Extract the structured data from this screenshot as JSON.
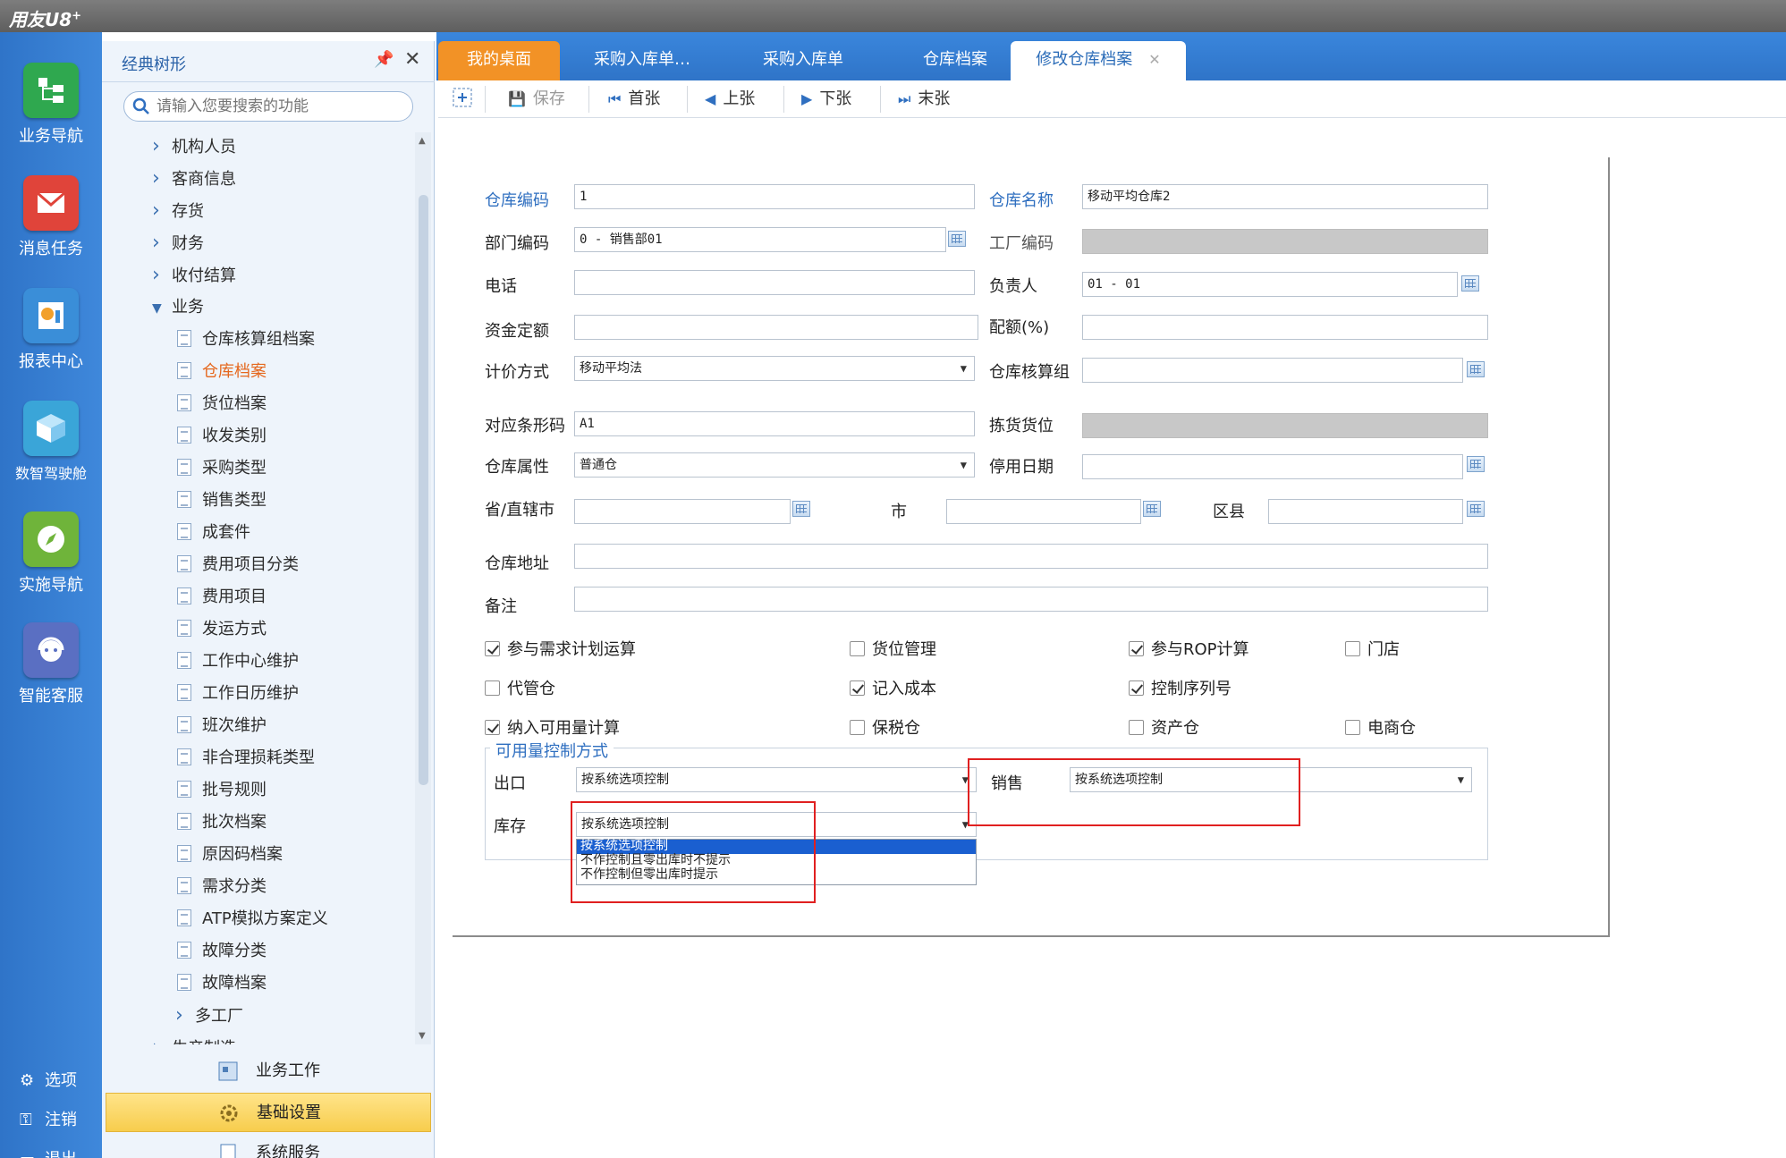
{
  "app": {
    "title": "用友U8",
    "title_sup": "+"
  },
  "rail": {
    "items": [
      {
        "label": "业务导航",
        "icon": "business-nav-icon",
        "color": "#2fa84f"
      },
      {
        "label": "消息任务",
        "icon": "message-task-icon",
        "color": "#e0443a"
      },
      {
        "label": "报表中心",
        "icon": "report-center-icon",
        "color": "#3a8ed8"
      },
      {
        "label": "数智驾驶舱",
        "icon": "cockpit-icon",
        "color": "#3aa5d8"
      },
      {
        "label": "实施导航",
        "icon": "compass-icon",
        "color": "#6fb43a"
      },
      {
        "label": "智能客服",
        "icon": "support-icon",
        "color": "#5a6fc2"
      }
    ],
    "options": "选项",
    "logout": "注销",
    "exit": "退出"
  },
  "tree": {
    "title": "经典树形",
    "search_placeholder": "请输入您要搜索的功能",
    "nodes": [
      {
        "label": "机构人员",
        "type": "folder",
        "level": 0
      },
      {
        "label": "客商信息",
        "type": "folder",
        "level": 0
      },
      {
        "label": "存货",
        "type": "folder",
        "level": 0
      },
      {
        "label": "财务",
        "type": "folder",
        "level": 0
      },
      {
        "label": "收付结算",
        "type": "folder",
        "level": 0
      },
      {
        "label": "业务",
        "type": "open",
        "level": 0
      },
      {
        "label": "仓库核算组档案",
        "type": "doc",
        "level": 1
      },
      {
        "label": "仓库档案",
        "type": "doc",
        "level": 1,
        "active": true
      },
      {
        "label": "货位档案",
        "type": "doc",
        "level": 1
      },
      {
        "label": "收发类别",
        "type": "doc",
        "level": 1
      },
      {
        "label": "采购类型",
        "type": "doc",
        "level": 1
      },
      {
        "label": "销售类型",
        "type": "doc",
        "level": 1
      },
      {
        "label": "成套件",
        "type": "doc",
        "level": 1
      },
      {
        "label": "费用项目分类",
        "type": "doc",
        "level": 1
      },
      {
        "label": "费用项目",
        "type": "doc",
        "level": 1
      },
      {
        "label": "发运方式",
        "type": "doc",
        "level": 1
      },
      {
        "label": "工作中心维护",
        "type": "doc",
        "level": 1
      },
      {
        "label": "工作日历维护",
        "type": "doc",
        "level": 1
      },
      {
        "label": "班次维护",
        "type": "doc",
        "level": 1
      },
      {
        "label": "非合理损耗类型",
        "type": "doc",
        "level": 1
      },
      {
        "label": "批号规则",
        "type": "doc",
        "level": 1
      },
      {
        "label": "批次档案",
        "type": "doc",
        "level": 1
      },
      {
        "label": "原因码档案",
        "type": "doc",
        "level": 1
      },
      {
        "label": "需求分类",
        "type": "doc",
        "level": 1
      },
      {
        "label": "ATP模拟方案定义",
        "type": "doc",
        "level": 1
      },
      {
        "label": "故障分类",
        "type": "doc",
        "level": 1
      },
      {
        "label": "故障档案",
        "type": "doc",
        "level": 1
      },
      {
        "label": "多工厂",
        "type": "folder",
        "level": 1
      },
      {
        "label": "生产制造",
        "type": "folder",
        "level": 0
      }
    ],
    "footer": [
      {
        "label": "业务工作",
        "selected": false
      },
      {
        "label": "基础设置",
        "selected": true
      },
      {
        "label": "系统服务",
        "selected": false
      }
    ]
  },
  "tabs": [
    {
      "label": "我的桌面",
      "kind": "home"
    },
    {
      "label": "采购入库单…",
      "kind": "normal"
    },
    {
      "label": "采购入库单",
      "kind": "normal"
    },
    {
      "label": "仓库档案",
      "kind": "normal"
    },
    {
      "label": "修改仓库档案",
      "kind": "active"
    }
  ],
  "toolbar": {
    "save": "保存",
    "first": "首张",
    "prev": "上张",
    "next": "下张",
    "last": "末张"
  },
  "form": {
    "code_label": "仓库编码",
    "code_value": "1",
    "name_label": "仓库名称",
    "name_value": "移动平均仓库2",
    "dept_label": "部门编码",
    "dept_value": "0 - 销售部01",
    "factory_label": "工厂编码",
    "factory_value": "",
    "phone_label": "电话",
    "phone_value": "",
    "owner_label": "负责人",
    "owner_value": "01 - 01",
    "fund_label": "资金定额",
    "fund_value": "",
    "quota_label": "配额(%)",
    "quota_value": "",
    "pricing_label": "计价方式",
    "pricing_value": "移动平均法",
    "acct_group_label": "仓库核算组",
    "acct_group_value": "",
    "barcode_label": "对应条形码",
    "barcode_value": "A1",
    "pick_label": "拣货货位",
    "pick_value": "",
    "attr_label": "仓库属性",
    "attr_value": "普通仓",
    "stop_date_label": "停用日期",
    "stop_date_value": "",
    "province_label": "省/直辖市",
    "province_value": "",
    "city_label": "市",
    "city_value": "",
    "district_label": "区县",
    "district_value": "",
    "address_label": "仓库地址",
    "address_value": "",
    "remark_label": "备注",
    "remark_value": "",
    "checks": [
      {
        "label": "参与需求计划运算",
        "checked": true
      },
      {
        "label": "货位管理",
        "checked": false
      },
      {
        "label": "参与ROP计算",
        "checked": true
      },
      {
        "label": "门店",
        "checked": false
      },
      {
        "label": "代管仓",
        "checked": false
      },
      {
        "label": "记入成本",
        "checked": true
      },
      {
        "label": "控制序列号",
        "checked": true
      },
      {
        "label": "纳入可用量计算",
        "checked": true
      },
      {
        "label": "保税仓",
        "checked": false
      },
      {
        "label": "资产仓",
        "checked": false
      },
      {
        "label": "电商仓",
        "checked": false
      }
    ],
    "group_title": "可用量控制方式",
    "export_label": "出口",
    "export_value": "按系统选项控制",
    "sales_label": "销售",
    "sales_value": "按系统选项控制",
    "stock_label": "库存",
    "stock_value": "按系统选项控制",
    "stock_options": [
      "按系统选项控制",
      "不作控制且零出库时不提示",
      "不作控制但零出库时提示"
    ]
  }
}
